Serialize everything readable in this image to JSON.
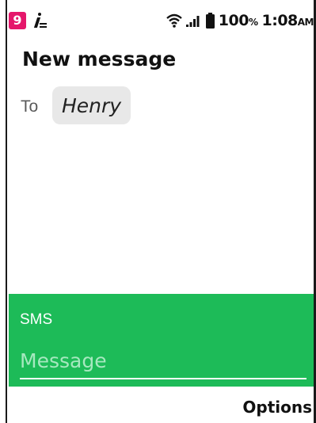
{
  "status_bar": {
    "notification_count": "9",
    "battery_percent": "100",
    "battery_unit": "%",
    "time": "1:08",
    "time_suffix": "AM"
  },
  "header": {
    "title": "New message"
  },
  "recipient": {
    "to_label": "To",
    "name": "Henry"
  },
  "compose": {
    "type_label": "SMS",
    "message_placeholder": "Message",
    "message_value": ""
  },
  "softkeys": {
    "right_label": "Options"
  },
  "colors": {
    "compose_background": "#1dbb58",
    "notification_badge": "#e5176b",
    "chip_background": "#e8e8e8"
  },
  "icons": [
    "notification-badge",
    "input-method-icon",
    "wifi-icon",
    "signal-icon",
    "battery-icon"
  ]
}
